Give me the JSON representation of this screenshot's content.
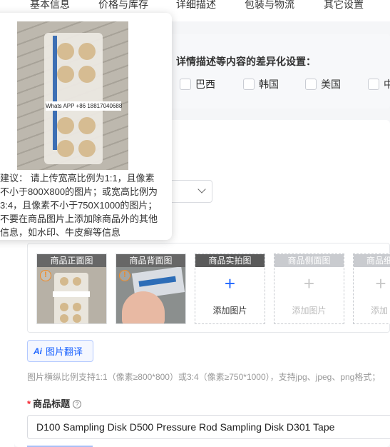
{
  "tabs": [
    "基本信息",
    "价格与库存",
    "详细描述",
    "包装与物流",
    "其它设置"
  ],
  "differentiation": {
    "title": "详情描述等内容的差异化设置：",
    "countries": [
      "巴西",
      "韩国",
      "美国",
      "中"
    ]
  },
  "tooltip": {
    "image_label": "Whats APP +86 18817040688",
    "advice": "建议：  请上传宽高比例为1:1，且像素\n不小于800X800的图片；或宽高比例为\n3:4，且像素不小于750X1000的图片；\n不要在商品图片上添加除商品外的其他\n信息，如水印、牛皮癣等信息"
  },
  "image_slots": [
    {
      "label": "商品正面图",
      "state": "filled"
    },
    {
      "label": "商品背面图",
      "state": "filled"
    },
    {
      "label": "商品实拍图",
      "state": "empty-active",
      "add_text": "添加图片"
    },
    {
      "label": "商品侧面图",
      "state": "empty-disabled",
      "add_text": "添加图片"
    },
    {
      "label": "商品细",
      "state": "empty-disabled",
      "add_text": "添加"
    }
  ],
  "translate_button": {
    "icon": "Ai",
    "label": "图片翻译"
  },
  "image_hint": "图片横纵比例支持1:1（像素≥800*800）或3:4（像素≥750*1000），支持jpg、jpeg、png格式；",
  "product_title": {
    "required_mark": "*",
    "label": "商品标题",
    "help_icon": "?",
    "value": "D100 Sampling Disk D500 Pressure Rod  Sampling Disk D301 Tape"
  },
  "colors": {
    "accent": "#1f66ff",
    "warning": "#f08a24",
    "required": "#f5222d"
  }
}
